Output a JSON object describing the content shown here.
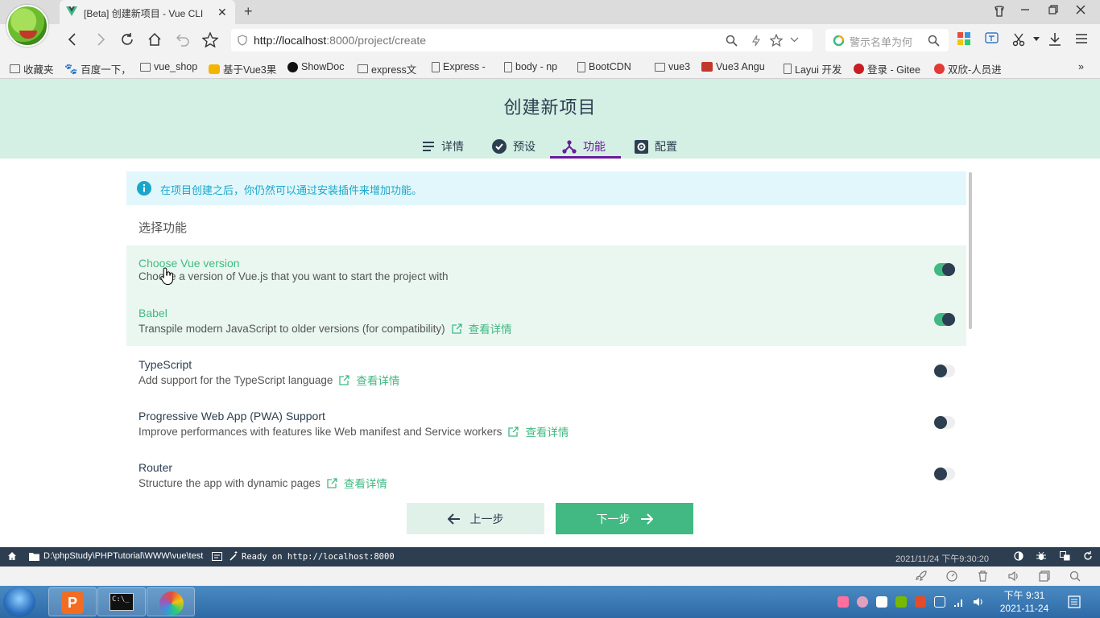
{
  "browser": {
    "tab_title": "[Beta] 创建新项目 - Vue CLI",
    "url_host": "http://localhost",
    "url_rest": ":8000/project/create",
    "search_placeholder": "警示名单为何",
    "bookmarks": [
      "收藏夹",
      "百度一下，",
      "vue_shop",
      "基于Vue3果",
      "ShowDoc",
      "express文",
      "Express -",
      "body - np",
      "BootCDN",
      "vue3",
      "Vue3 Angu",
      "Layui 开发",
      "登录 - Gitee",
      "双欣-人员进"
    ],
    "bookmarks_more": "»"
  },
  "app": {
    "title": "创建新项目",
    "steps": [
      {
        "label": "详情",
        "icon": "list-icon",
        "active": false
      },
      {
        "label": "预设",
        "icon": "check-circle-icon",
        "active": false
      },
      {
        "label": "功能",
        "icon": "features-icon",
        "active": true
      },
      {
        "label": "配置",
        "icon": "settings-icon",
        "active": false
      }
    ],
    "info_text": "在项目创建之后，你仍然可以通过安装插件来增加功能。",
    "section_title": "选择功能",
    "more_info_label": "查看详情",
    "features": [
      {
        "name": "Choose Vue version",
        "description": "Choose a version of Vue.js that you want to start the project with",
        "enabled": true,
        "has_link": false
      },
      {
        "name": "Babel",
        "description": "Transpile modern JavaScript to older versions (for compatibility)",
        "enabled": true,
        "has_link": true
      },
      {
        "name": "TypeScript",
        "description": "Add support for the TypeScript language",
        "enabled": false,
        "has_link": true
      },
      {
        "name": "Progressive Web App (PWA) Support",
        "description": "Improve performances with features like Web manifest and Service workers",
        "enabled": false,
        "has_link": true
      },
      {
        "name": "Router",
        "description": "Structure the app with dynamic pages",
        "enabled": false,
        "has_link": true
      }
    ],
    "prev_label": "上一步",
    "next_label": "下一步"
  },
  "statusbar": {
    "path": "D:\\phpStudy\\PHPTutorial\\WWW\\vue\\test",
    "ready": "Ready on http://localhost:8000",
    "datetime": "2021/11/24 下午9:30:20"
  },
  "taskbar": {
    "time": "下午 9:31",
    "date": "2021-11-24"
  },
  "colors": {
    "accent": "#42b983",
    "header_bg": "#d4efe3",
    "active_step": "#6a1b9a",
    "dark": "#2c3e50",
    "info": "#1aa6c9"
  }
}
